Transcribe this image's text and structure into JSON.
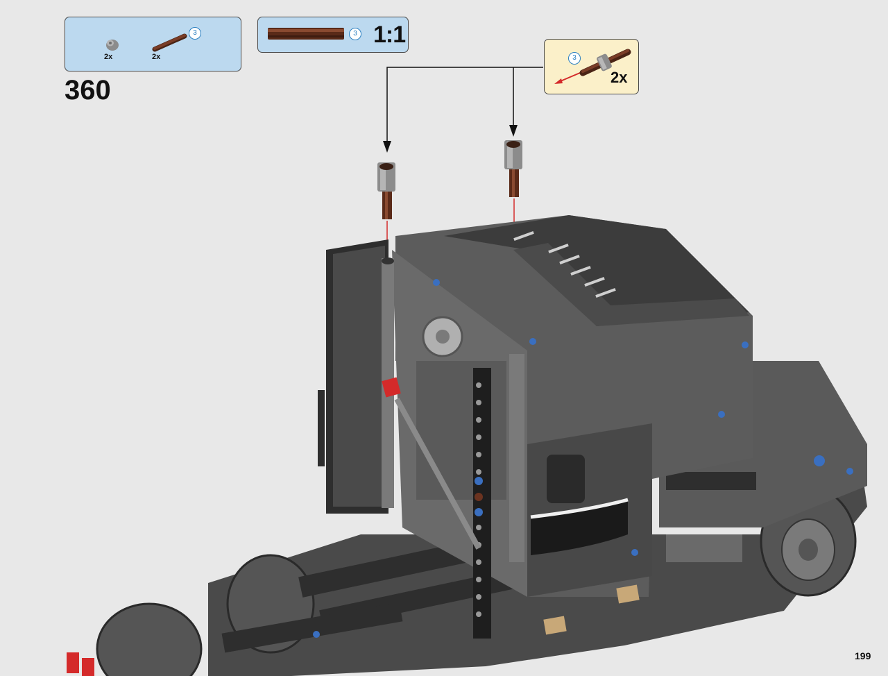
{
  "instruction_page": {
    "step_number": "360",
    "page_number": "199"
  },
  "parts_list": {
    "items": [
      {
        "part": "bushing-gray",
        "quantity": "2x"
      },
      {
        "part": "axle-brown",
        "quantity": "2x",
        "length_badge": "3"
      }
    ]
  },
  "scale_reference": {
    "part": "axle-brown",
    "length_badge": "3",
    "scale_label": "1:1"
  },
  "subassembly_callout": {
    "length_badge": "3",
    "quantity": "2x"
  },
  "colors": {
    "parts_box_bg": "#bcd9ef",
    "callout_bg": "#fbf0c9",
    "axle_brown": "#6b3320",
    "bushing_gray": "#8c8c8c",
    "insert_arrow_red": "#d42a2a",
    "truck_dark": "#3c3c3c"
  }
}
